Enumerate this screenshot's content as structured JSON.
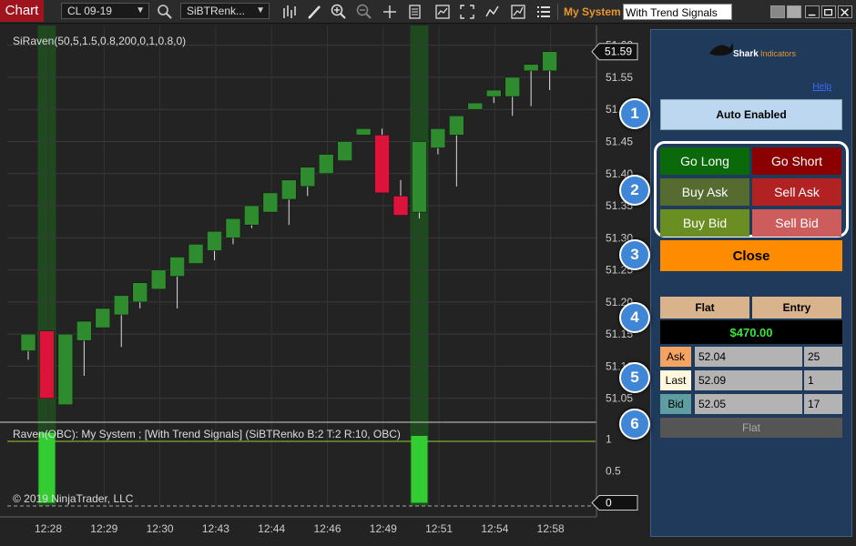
{
  "toolbar": {
    "chart_tab": "Chart",
    "instrument": "CL 09-19",
    "bar_type": "SiBTRenk...",
    "strategy_label": "My System",
    "strategy_value": "With Trend Signals"
  },
  "chart": {
    "indicator_label": "SiRaven(50,5,1.5,0.8,200,0,1,0.8,0)",
    "subpanel_label": "Raven(OBC): My System ; [With Trend Signals] (SiBTRenko B:2 T:2 R:10, OBC)",
    "copyright": "© 2019 NinjaTrader, LLC",
    "last_price": "51.59",
    "sub_last_value": "0",
    "price_ticks": [
      "51.60",
      "51.55",
      "51.50",
      "51.45",
      "51.40",
      "51.35",
      "51.30",
      "51.25",
      "51.20",
      "51.15",
      "51.10",
      "51.05"
    ],
    "sub_ticks": [
      "1",
      "0.5"
    ],
    "time_labels": [
      "12:28",
      "12:29",
      "12:30",
      "12:43",
      "12:44",
      "12:46",
      "12:49",
      "12:51",
      "12:54",
      "12:58"
    ],
    "colors": {
      "up": "#2e8b2e",
      "down": "#dc143c",
      "signal": "#33cc33",
      "highlight": "#1f4a1f"
    }
  },
  "chart_data": {
    "type": "candlestick",
    "candles": [
      {
        "o": 51.124,
        "c": 51.15,
        "h": 51.15,
        "l": 51.11,
        "dir": "up"
      },
      {
        "o": 51.155,
        "c": 51.05,
        "h": 51.155,
        "l": 51.05,
        "dir": "down"
      },
      {
        "o": 51.04,
        "c": 51.15,
        "h": 51.15,
        "l": 51.04,
        "dir": "up"
      },
      {
        "o": 51.14,
        "c": 51.17,
        "h": 51.17,
        "l": 51.085,
        "dir": "up"
      },
      {
        "o": 51.16,
        "c": 51.19,
        "h": 51.19,
        "l": 51.16,
        "dir": "up"
      },
      {
        "o": 51.18,
        "c": 51.21,
        "h": 51.21,
        "l": 51.13,
        "dir": "up"
      },
      {
        "o": 51.2,
        "c": 51.23,
        "h": 51.23,
        "l": 51.19,
        "dir": "up"
      },
      {
        "o": 51.22,
        "c": 51.25,
        "h": 51.25,
        "l": 51.22,
        "dir": "up"
      },
      {
        "o": 51.24,
        "c": 51.27,
        "h": 51.27,
        "l": 51.19,
        "dir": "up"
      },
      {
        "o": 51.26,
        "c": 51.29,
        "h": 51.29,
        "l": 51.26,
        "dir": "up"
      },
      {
        "o": 51.28,
        "c": 51.31,
        "h": 51.31,
        "l": 51.265,
        "dir": "up"
      },
      {
        "o": 51.3,
        "c": 51.33,
        "h": 51.33,
        "l": 51.29,
        "dir": "up"
      },
      {
        "o": 51.32,
        "c": 51.35,
        "h": 51.35,
        "l": 51.315,
        "dir": "up"
      },
      {
        "o": 51.34,
        "c": 51.37,
        "h": 51.37,
        "l": 51.34,
        "dir": "up"
      },
      {
        "o": 51.36,
        "c": 51.39,
        "h": 51.39,
        "l": 51.32,
        "dir": "up"
      },
      {
        "o": 51.38,
        "c": 51.41,
        "h": 51.41,
        "l": 51.365,
        "dir": "up"
      },
      {
        "o": 51.4,
        "c": 51.43,
        "h": 51.43,
        "l": 51.4,
        "dir": "up"
      },
      {
        "o": 51.42,
        "c": 51.45,
        "h": 51.45,
        "l": 51.42,
        "dir": "up"
      },
      {
        "o": 51.46,
        "c": 51.47,
        "h": 51.47,
        "l": 51.46,
        "dir": "up"
      },
      {
        "o": 51.46,
        "c": 51.37,
        "h": 51.47,
        "l": 51.37,
        "dir": "down"
      },
      {
        "o": 51.365,
        "c": 51.335,
        "h": 51.39,
        "l": 51.335,
        "dir": "down"
      },
      {
        "o": 51.34,
        "c": 51.45,
        "h": 51.45,
        "l": 51.33,
        "dir": "up"
      },
      {
        "o": 51.44,
        "c": 51.47,
        "h": 51.47,
        "l": 51.43,
        "dir": "up"
      },
      {
        "o": 51.46,
        "c": 51.49,
        "h": 51.49,
        "l": 51.38,
        "dir": "up"
      },
      {
        "o": 51.5,
        "c": 51.51,
        "h": 51.51,
        "l": 51.5,
        "dir": "up"
      },
      {
        "o": 51.52,
        "c": 51.53,
        "h": 51.53,
        "l": 51.51,
        "dir": "up"
      },
      {
        "o": 51.52,
        "c": 51.55,
        "h": 51.55,
        "l": 51.49,
        "dir": "up"
      },
      {
        "o": 51.56,
        "c": 51.57,
        "h": 51.57,
        "l": 51.505,
        "dir": "up"
      },
      {
        "o": 51.56,
        "c": 51.59,
        "h": 51.59,
        "l": 51.53,
        "dir": "up"
      }
    ],
    "highlighted_candles": [
      1,
      21
    ],
    "signal_values": [
      {
        "candle": 1,
        "value": 1.1
      },
      {
        "candle": 21,
        "value": 1.05
      }
    ],
    "y_range": [
      51.017,
      51.625
    ],
    "sub_y_range": [
      -0.05,
      1.25
    ]
  },
  "panel": {
    "logo_text_1": "Shark",
    "logo_text_2": "Indicators",
    "help": "Help",
    "auto": "Auto Enabled",
    "go_long": "Go Long",
    "go_short": "Go Short",
    "buy_ask": "Buy Ask",
    "sell_ask": "Sell Ask",
    "buy_bid": "Buy Bid",
    "sell_bid": "Sell Bid",
    "close": "Close",
    "flat_hdr": "Flat",
    "entry_hdr": "Entry",
    "pnl": "$470.00",
    "ask_label": "Ask",
    "ask_price": "52.04",
    "ask_size": "25",
    "last_label": "Last",
    "last_price": "52.09",
    "last_size": "1",
    "bid_label": "Bid",
    "bid_price": "52.05",
    "bid_size": "17",
    "flat_bottom": "Flat",
    "badges": [
      "1",
      "2",
      "3",
      "4",
      "5",
      "6"
    ]
  }
}
